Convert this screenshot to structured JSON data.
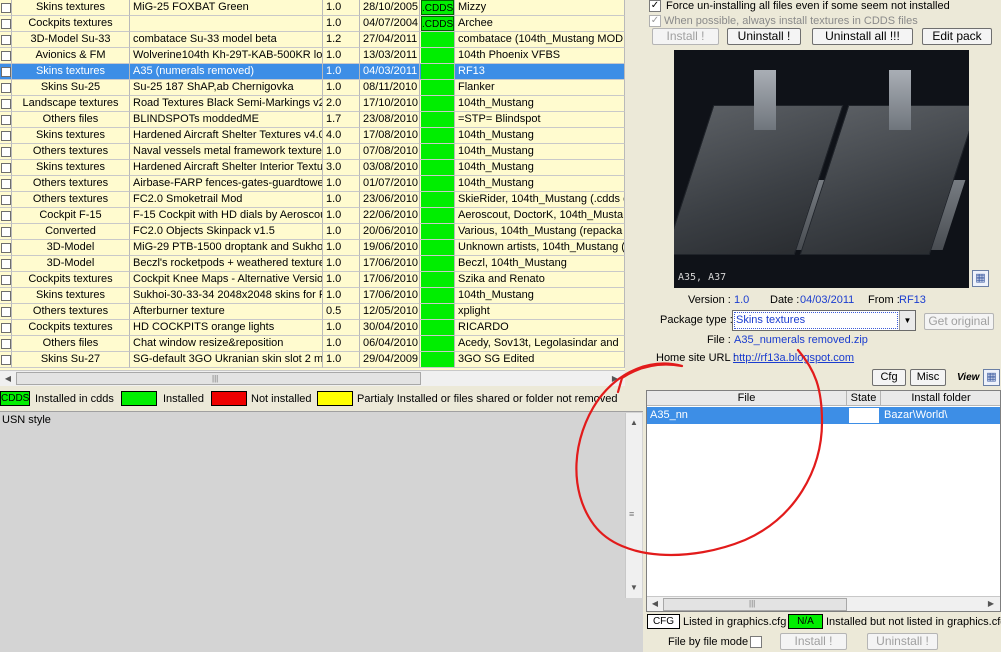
{
  "table": {
    "rows": [
      {
        "type": "Skins textures",
        "name": "MiG-25 FOXBAT Green",
        "version": "1.0",
        "date": "28/10/2005",
        "status": "cdds",
        "status_label": ".CDDS",
        "author": "Mizzy"
      },
      {
        "type": "Cockpits textures",
        "name": "",
        "version": "1.0",
        "date": "04/07/2004",
        "status": "cdds",
        "status_label": ".CDDS",
        "author": "Archee"
      },
      {
        "type": "3D-Model Su-33",
        "name": "combatace Su-33 model beta",
        "version": "1.2",
        "date": "27/04/2011",
        "status": "installed",
        "status_label": "",
        "author": "combatace (104th_Mustang MODM"
      },
      {
        "type": "Avionics & FM",
        "name": "Wolverine104th Kh-29T-KAB-500KR loa",
        "version": "1.0",
        "date": "13/03/2011",
        "status": "installed",
        "status_label": "",
        "author": "104th Phoenix VFBS"
      },
      {
        "type": "Skins textures",
        "name": "A35 (numerals removed)",
        "version": "1.0",
        "date": "04/03/2011",
        "status": "installed",
        "status_label": "",
        "author": "RF13",
        "selected": true
      },
      {
        "type": "Skins Su-25",
        "name": "Su-25 187 ShAP,ab Chernigovka",
        "version": "1.0",
        "date": "08/11/2010",
        "status": "installed",
        "status_label": "",
        "author": "Flanker"
      },
      {
        "type": "Landscape textures",
        "name": "Road Textures Black Semi-Markings v2",
        "version": "2.0",
        "date": "17/10/2010",
        "status": "installed",
        "status_label": "",
        "author": "104th_Mustang"
      },
      {
        "type": "Others files",
        "name": "BLINDSPOTs moddedME",
        "version": "1.7",
        "date": "23/08/2010",
        "status": "installed",
        "status_label": "",
        "author": "=STP= Blindspot"
      },
      {
        "type": "Skins textures",
        "name": "Hardened Aircraft Shelter Textures v4.0",
        "version": "4.0",
        "date": "17/08/2010",
        "status": "installed",
        "status_label": "",
        "author": "104th_Mustang"
      },
      {
        "type": "Others textures",
        "name": "Naval vessels metal framework texture",
        "version": "1.0",
        "date": "07/08/2010",
        "status": "installed",
        "status_label": "",
        "author": "104th_Mustang"
      },
      {
        "type": "Skins textures",
        "name": "Hardened Aircraft Shelter Interior Textu",
        "version": "3.0",
        "date": "03/08/2010",
        "status": "installed",
        "status_label": "",
        "author": "104th_Mustang"
      },
      {
        "type": "Others textures",
        "name": "Airbase-FARP fences-gates-guardtowe",
        "version": "1.0",
        "date": "01/07/2010",
        "status": "installed",
        "status_label": "",
        "author": "104th_Mustang"
      },
      {
        "type": "Others textures",
        "name": "FC2.0 Smoketrail Mod",
        "version": "1.0",
        "date": "23/06/2010",
        "status": "installed",
        "status_label": "",
        "author": "SkieRider, 104th_Mustang (.cdds c"
      },
      {
        "type": "Cockpit F-15",
        "name": "F-15 Cockpit with HD dials by Aeroscout",
        "version": "1.0",
        "date": "22/06/2010",
        "status": "installed",
        "status_label": "",
        "author": "Aeroscout, DoctorK, 104th_Musta"
      },
      {
        "type": "Converted",
        "name": "FC2.0 Objects Skinpack v1.5",
        "version": "1.0",
        "date": "20/06/2010",
        "status": "installed",
        "status_label": "",
        "author": "Various, 104th_Mustang (repacka"
      },
      {
        "type": "3D-Model",
        "name": "MiG-29 PTB-1500 droptank and Sukhoi I",
        "version": "1.0",
        "date": "19/06/2010",
        "status": "installed",
        "status_label": "",
        "author": "Unknown artists, 104th_Mustang ("
      },
      {
        "type": "3D-Model",
        "name": "Beczl's rocketpods + weathered texture",
        "version": "1.0",
        "date": "17/06/2010",
        "status": "installed",
        "status_label": "",
        "author": "Beczl, 104th_Mustang"
      },
      {
        "type": "Cockpits textures",
        "name": "Cockpit Knee Maps - Alternative Version",
        "version": "1.0",
        "date": "17/06/2010",
        "status": "installed",
        "status_label": "",
        "author": "Szika and Renato"
      },
      {
        "type": "Skins textures",
        "name": "Sukhoi-30-33-34 2048x2048 skins for F",
        "version": "1.0",
        "date": "17/06/2010",
        "status": "installed",
        "status_label": "",
        "author": "104th_Mustang"
      },
      {
        "type": "Others textures",
        "name": "Afterburner texture",
        "version": "0.5",
        "date": "12/05/2010",
        "status": "installed",
        "status_label": "",
        "author": "xplight"
      },
      {
        "type": "Cockpits textures",
        "name": " HD COCKPITS orange lights",
        "version": "1.0",
        "date": "30/04/2010",
        "status": "installed",
        "status_label": "",
        "author": "RICARDO"
      },
      {
        "type": "Others files",
        "name": "Chat window resize&reposition",
        "version": "1.0",
        "date": "06/04/2010",
        "status": "installed",
        "status_label": "",
        "author": "Acedy, Sov13t, Legolasindar and"
      },
      {
        "type": "Skins Su-27",
        "name": "SG-default 3GO Ukranian skin slot 2 mo",
        "version": "1.0",
        "date": "29/04/2009",
        "status": "installed",
        "status_label": "",
        "author": "3GO SG Edited"
      }
    ]
  },
  "legend": {
    "cdds_box": "CDDS",
    "cdds": "Installed in cdds",
    "installed": "Installed",
    "not_installed": "Not installed",
    "partial": "Partialy Installed or files shared or folder not removed"
  },
  "description": {
    "text": "USN style"
  },
  "options": {
    "force_uninstall": "Force un-installing all files even if some seem not installed",
    "cdds_install": "When possible, always install textures in CDDS files"
  },
  "buttons": {
    "install": "Install !",
    "uninstall": "Uninstall !",
    "uninstall_all": "Uninstall all !!!",
    "edit_pack": "Edit pack",
    "get_original": "Get original",
    "cfg": "Cfg",
    "misc": "Misc",
    "view": "View"
  },
  "preview": {
    "caption": "A35, A37"
  },
  "details": {
    "version_label": "Version :",
    "version": "1.0",
    "date_label": "Date :",
    "date": "04/03/2011",
    "from_label": "From :",
    "from": "RF13",
    "package_type_label": "Package type :",
    "package_type": "Skins textures",
    "file_label": "File :",
    "file": "A35_numerals removed.zip",
    "home_label": "Home site URL :",
    "home_url": "http://rf13a.blogspot.com"
  },
  "files": {
    "headers": [
      "File",
      "State",
      "Install folder"
    ],
    "rows": [
      {
        "file": "A35_nn",
        "state": "",
        "folder": "Bazar\\World\\"
      }
    ]
  },
  "cfg_legend": {
    "cfg_box": "CFG",
    "cfg": "Listed in graphics.cfg",
    "na_box": "N/A",
    "na": "Installed but not listed in graphics.cfg"
  },
  "bottom": {
    "file_by_file": "File by file mode",
    "install": "Install !",
    "uninstall": "Uninstall !"
  },
  "colors": {
    "selection": "#3d8ee6",
    "installed": "#00ee00",
    "not_installed": "#ee0000",
    "partial": "#ffff00",
    "annotation": "#e21b1b"
  }
}
